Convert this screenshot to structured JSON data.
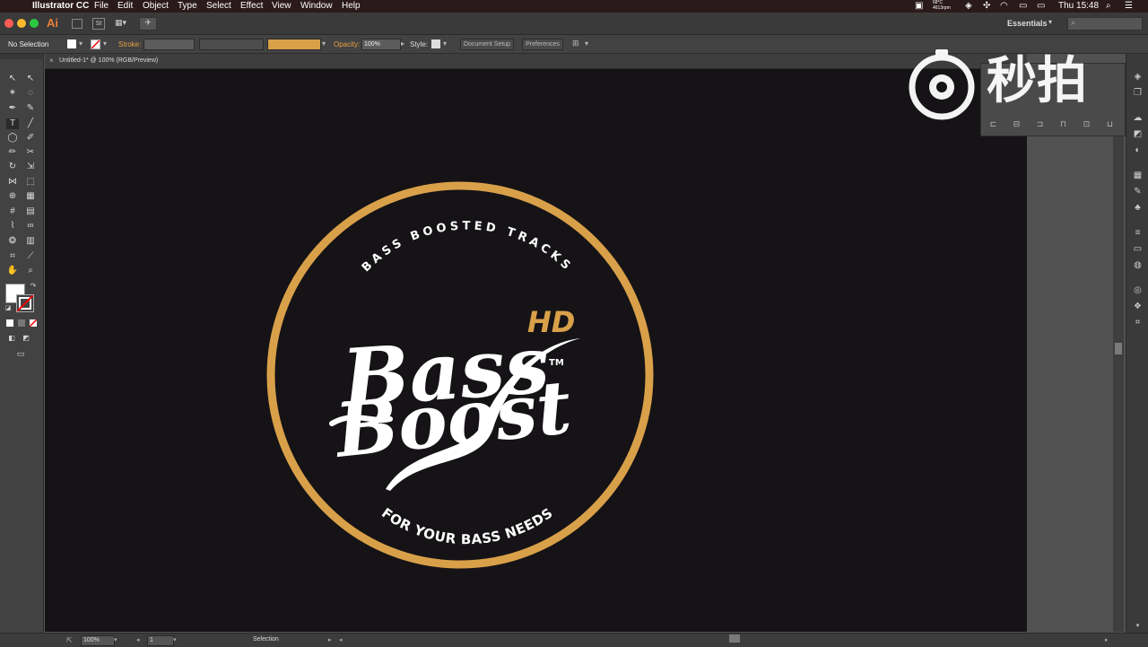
{
  "menubar": {
    "app_name": "Illustrator CC",
    "menus": [
      "File",
      "Edit",
      "Object",
      "Type",
      "Select",
      "Effect",
      "View",
      "Window",
      "Help"
    ],
    "temp": "68°C",
    "rpm": "4613rpm",
    "clock": "Thu 15:48"
  },
  "appbar": {
    "logo": "Ai",
    "workspace": "Essentials"
  },
  "control_bar": {
    "selection_label": "No Selection",
    "stroke_label": "Stroke:",
    "opacity_label": "Opacity:",
    "opacity_value": "100%",
    "style_label": "Style:",
    "doc_setup_button": "Document Setup",
    "preferences_button": "Preferences"
  },
  "document": {
    "tab_title": "Untitled-1* @ 100% (RGB/Preview)"
  },
  "artwork": {
    "ring_color": "#d9a04a",
    "text_color": "#ffffff",
    "top_text": "BASS BOOSTED TRACKS",
    "bottom_text": "FOR YOUR BASS NEEDS",
    "hd_text": "HD",
    "tm_text": "TM",
    "script_line1": "Bass",
    "script_line2": "Boost"
  },
  "status_bar": {
    "zoom": "100%",
    "page": "1",
    "tool": "Selection"
  },
  "watermark": {
    "text": "秒拍"
  },
  "colors": {
    "accent_gold": "#d9a04a",
    "canvas": "#151316",
    "panel": "#424242"
  }
}
